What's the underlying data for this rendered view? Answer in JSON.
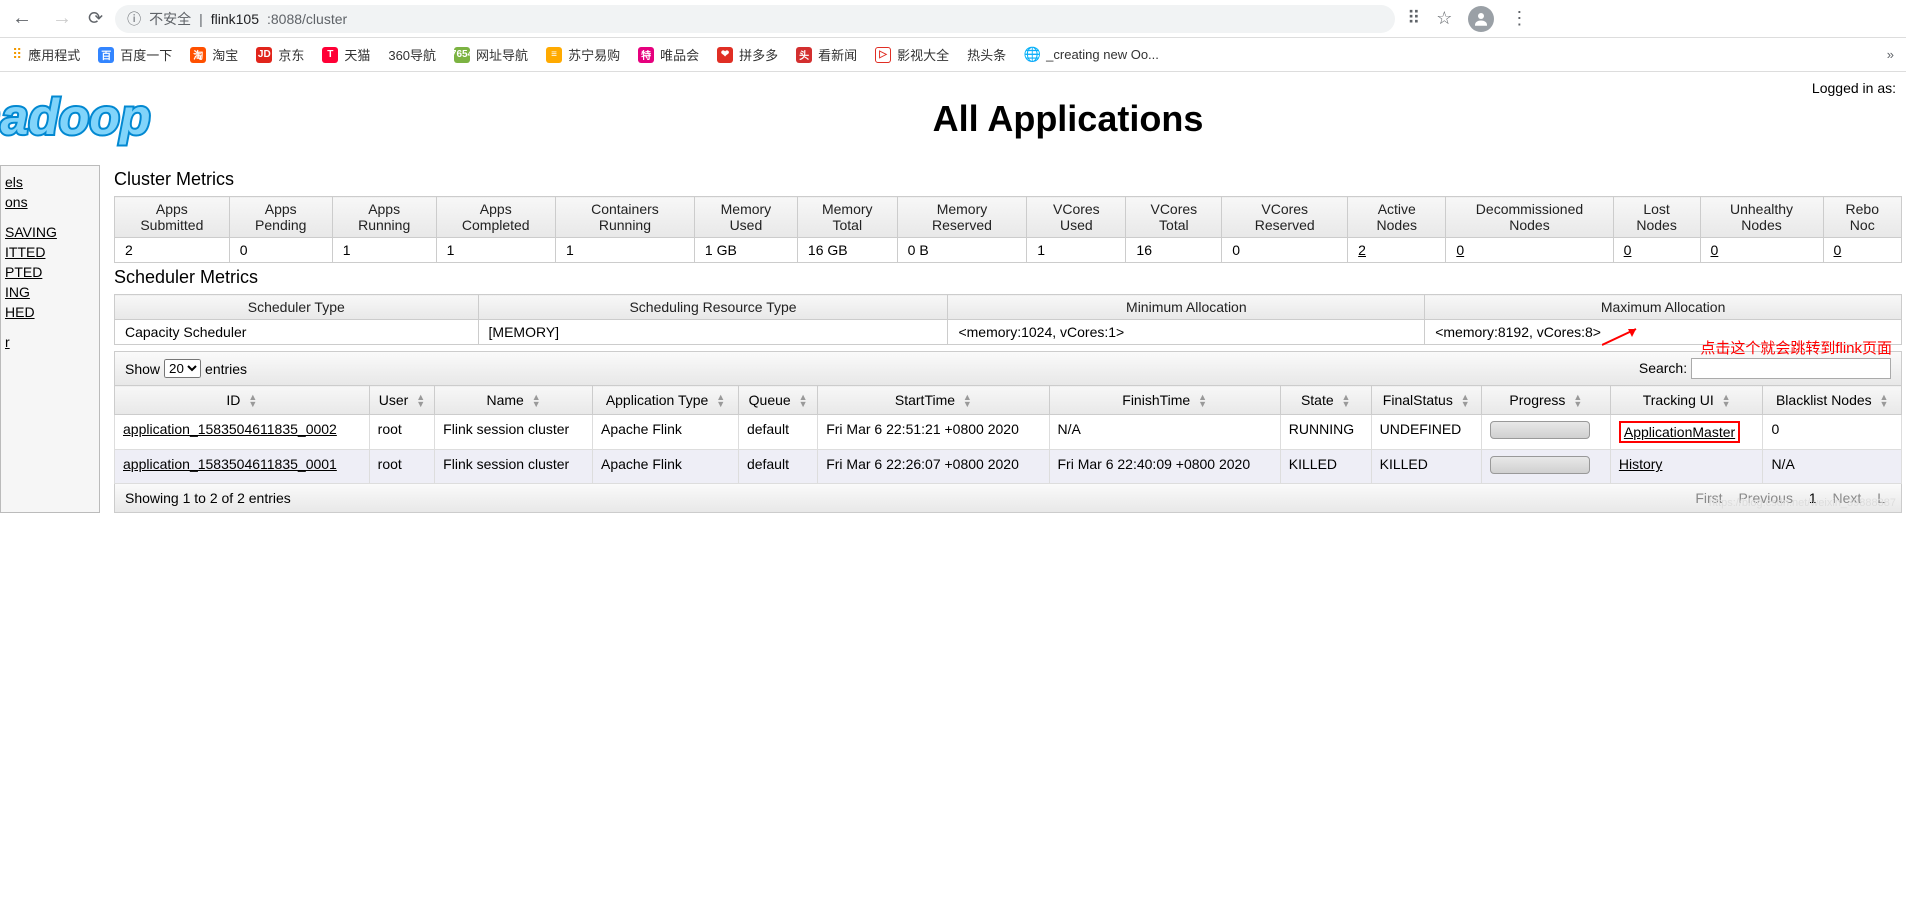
{
  "browser": {
    "insecure_label": "不安全",
    "url_host": "flink105",
    "url_path": ":8088/cluster"
  },
  "bookmarks": {
    "apps": "應用程式",
    "items": [
      {
        "label": "百度一下",
        "color": "#3385ff",
        "glyph": "百"
      },
      {
        "label": "淘宝",
        "color": "#ff5000",
        "glyph": "淘"
      },
      {
        "label": "京东",
        "color": "#e1251b",
        "glyph": "JD"
      },
      {
        "label": "天猫",
        "color": "#ff0036",
        "glyph": "T"
      },
      {
        "label": "360导航",
        "color": "#ffffff",
        "glyph": ""
      },
      {
        "label": "网址导航",
        "color": "#7cb342",
        "glyph": "7654"
      },
      {
        "label": "苏宁易购",
        "color": "#ffaa00",
        "glyph": "≡"
      },
      {
        "label": "唯品会",
        "color": "#e6007e",
        "glyph": "特"
      },
      {
        "label": "拼多多",
        "color": "#e02e24",
        "glyph": "❤"
      },
      {
        "label": "看新闻",
        "color": "#d32f2f",
        "glyph": "头"
      },
      {
        "label": "影视大全",
        "color": "#ffffff",
        "glyph": "▷"
      },
      {
        "label": "热头条",
        "color": "",
        "glyph": ""
      },
      {
        "label": "_creating new Oo...",
        "color": "#888",
        "glyph": "🌐"
      }
    ]
  },
  "page": {
    "logged_in": "Logged in as: ",
    "title": "All Applications"
  },
  "sidebar": {
    "items": [
      "els",
      "ons",
      "",
      "SAVING",
      "ITTED",
      "PTED",
      "ING",
      "HED",
      "",
      "r"
    ]
  },
  "cluster_metrics": {
    "title": "Cluster Metrics",
    "headers": [
      "Apps Submitted",
      "Apps Pending",
      "Apps Running",
      "Apps Completed",
      "Containers Running",
      "Memory Used",
      "Memory Total",
      "Memory Reserved",
      "VCores Used",
      "VCores Total",
      "VCores Reserved",
      "Active Nodes",
      "Decommissioned Nodes",
      "Lost Nodes",
      "Unhealthy Nodes",
      "Rebo Noc"
    ],
    "values": [
      "2",
      "0",
      "1",
      "1",
      "1",
      "1 GB",
      "16 GB",
      "0 B",
      "1",
      "16",
      "0",
      "2",
      "0",
      "0",
      "0",
      "0"
    ]
  },
  "scheduler_metrics": {
    "title": "Scheduler Metrics",
    "headers": [
      "Scheduler Type",
      "Scheduling Resource Type",
      "Minimum Allocation",
      "Maximum Allocation"
    ],
    "values": [
      "Capacity Scheduler",
      "[MEMORY]",
      "<memory:1024, vCores:1>",
      "<memory:8192, vCores:8>"
    ]
  },
  "datatable": {
    "show_label": "Show",
    "entries_label": "entries",
    "show_value": "20",
    "search_label": "Search:",
    "columns": [
      "ID",
      "User",
      "Name",
      "Application Type",
      "Queue",
      "StartTime",
      "FinishTime",
      "State",
      "FinalStatus",
      "Progress",
      "Tracking UI",
      "Blacklist Nodes"
    ],
    "rows": [
      {
        "id": "application_1583504611835_0002",
        "user": "root",
        "name": "Flink session cluster",
        "type": "Apache Flink",
        "queue": "default",
        "start": "Fri Mar 6 22:51:21 +0800 2020",
        "finish": "N/A",
        "state": "RUNNING",
        "final": "UNDEFINED",
        "tracking": "ApplicationMaster",
        "blacklist": "0"
      },
      {
        "id": "application_1583504611835_0001",
        "user": "root",
        "name": "Flink session cluster",
        "type": "Apache Flink",
        "queue": "default",
        "start": "Fri Mar 6 22:26:07 +0800 2020",
        "finish": "Fri Mar 6 22:40:09 +0800 2020",
        "state": "KILLED",
        "final": "KILLED",
        "tracking": "History",
        "blacklist": "N/A"
      }
    ],
    "footer_info": "Showing 1 to 2 of 2 entries",
    "pager": {
      "first": "First",
      "prev": "Previous",
      "page": "1",
      "next": "Next",
      "last": "L"
    }
  },
  "annotation": "点击这个就会跳转到flink页面",
  "watermark": "https://blog.csdn.net/weixin_39888387"
}
